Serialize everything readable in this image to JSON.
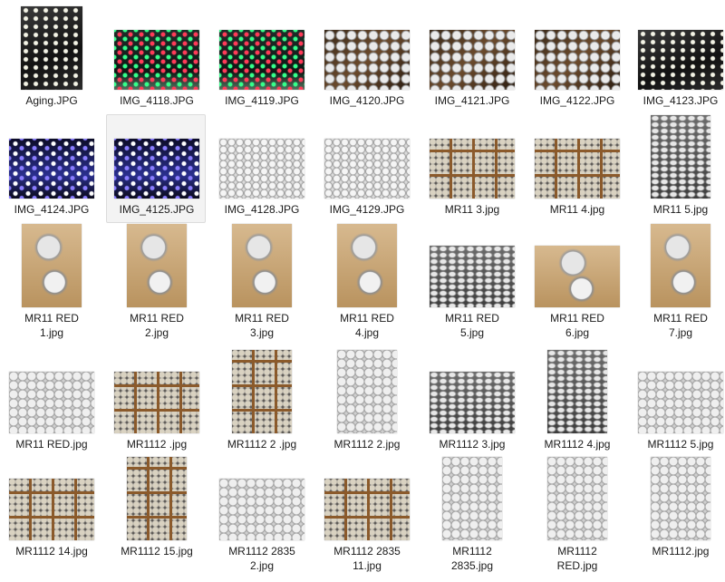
{
  "files": [
    {
      "name": "Aging.JPG",
      "thumb": "t-dark-led",
      "selected": false
    },
    {
      "name": "IMG_4118.JPG",
      "thumb": "t-rgb-led",
      "selected": false
    },
    {
      "name": "IMG_4119.JPG",
      "thumb": "t-rgb-led",
      "selected": false
    },
    {
      "name": "IMG_4120.JPG",
      "thumb": "t-box-cups",
      "selected": false
    },
    {
      "name": "IMG_4121.JPG",
      "thumb": "t-box-cups",
      "selected": false
    },
    {
      "name": "IMG_4122.JPG",
      "thumb": "t-box-cups",
      "selected": false
    },
    {
      "name": "IMG_4123.JPG",
      "thumb": "t-dark-led",
      "selected": false
    },
    {
      "name": "IMG_4124.JPG",
      "thumb": "t-blue-led",
      "selected": false
    },
    {
      "name": "IMG_4125.JPG",
      "thumb": "t-blue-led",
      "selected": true
    },
    {
      "name": "IMG_4128.JPG",
      "thumb": "t-box-loose",
      "selected": false
    },
    {
      "name": "IMG_4129.JPG",
      "thumb": "t-box-loose",
      "selected": false
    },
    {
      "name": "MR11 3.jpg",
      "thumb": "t-box-grid",
      "selected": false
    },
    {
      "name": "MR11 4.jpg",
      "thumb": "t-box-grid",
      "selected": false
    },
    {
      "name": "MR11 5.jpg",
      "thumb": "t-rows",
      "selected": false
    },
    {
      "name": "MR11 RED\n1.jpg",
      "thumb": "t-bulbs",
      "selected": false
    },
    {
      "name": "MR11 RED\n2.jpg",
      "thumb": "t-bulbs",
      "selected": false
    },
    {
      "name": "MR11 RED\n3.jpg",
      "thumb": "t-bulbs",
      "selected": false
    },
    {
      "name": "MR11 RED\n4.jpg",
      "thumb": "t-bulbs",
      "selected": false
    },
    {
      "name": "MR11 RED\n5.jpg",
      "thumb": "t-rows",
      "selected": false
    },
    {
      "name": "MR11 RED\n6.jpg",
      "thumb": "t-bulbs",
      "selected": false
    },
    {
      "name": "MR11 RED\n7.jpg",
      "thumb": "t-bulbs",
      "selected": false
    },
    {
      "name": "MR11 RED.jpg",
      "thumb": "t-pile",
      "selected": false
    },
    {
      "name": "MR1112 .jpg",
      "thumb": "t-box-grid",
      "selected": false
    },
    {
      "name": "MR1112 2 .jpg",
      "thumb": "t-box-grid",
      "selected": false
    },
    {
      "name": "MR1112 2.jpg",
      "thumb": "t-pile",
      "selected": false
    },
    {
      "name": "MR1112 3.jpg",
      "thumb": "t-rows",
      "selected": false
    },
    {
      "name": "MR1112 4.jpg",
      "thumb": "t-rows",
      "selected": false
    },
    {
      "name": "MR1112 5.jpg",
      "thumb": "t-pile",
      "selected": false
    },
    {
      "name": "MR1112 14.jpg",
      "thumb": "t-box-grid",
      "selected": false
    },
    {
      "name": "MR1112 15.jpg",
      "thumb": "t-box-grid",
      "selected": false
    },
    {
      "name": "MR1112 2835\n2.jpg",
      "thumb": "t-pile",
      "selected": false
    },
    {
      "name": "MR1112 2835\n11.jpg",
      "thumb": "t-box-grid",
      "selected": false
    },
    {
      "name": "MR1112\n2835.jpg",
      "thumb": "t-pile",
      "selected": false
    },
    {
      "name": "MR1112\nRED.jpg",
      "thumb": "t-pile",
      "selected": false
    },
    {
      "name": "MR1112.jpg",
      "thumb": "t-pile",
      "selected": false
    }
  ]
}
